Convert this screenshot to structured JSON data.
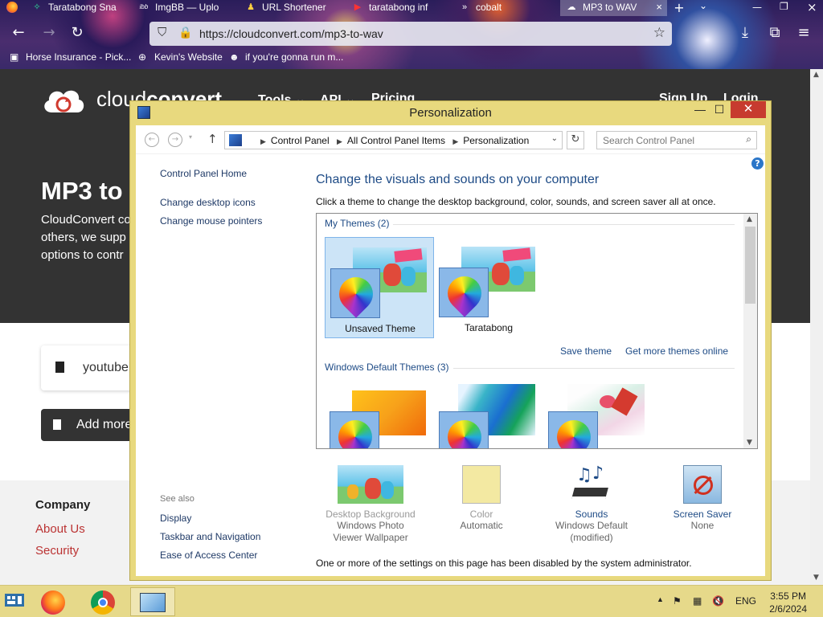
{
  "browser": {
    "tabs": [
      {
        "label": "Taratabong Sna",
        "icon": "✧"
      },
      {
        "label": "ImgBB — Uplo",
        "icon": "ibb"
      },
      {
        "label": "URL Shortener",
        "icon": "♟"
      },
      {
        "label": "taratabong inf",
        "icon": "▶"
      },
      {
        "label": "cobalt",
        "icon": "»"
      },
      {
        "label": "MP3 to WAV",
        "icon": "☁"
      }
    ],
    "url": "https://cloudconvert.com/mp3-to-wav",
    "bookmarks": [
      "Horse Insurance - Pick...",
      "Kevin's Website",
      "if you're gonna run m..."
    ]
  },
  "site": {
    "brand_light": "cloud",
    "brand_bold": "convert",
    "menu": [
      "Tools ⌄",
      "API ⌄",
      "Pricing"
    ],
    "menu_right": [
      "Sign Up",
      "Login"
    ],
    "heading": "MP3 to",
    "description": [
      "CloudConvert co",
      "others, we supp",
      "options to contr"
    ],
    "file_label": "youtube",
    "add_more": "Add more",
    "footer": {
      "company": "Company",
      "links": [
        "About Us",
        "Security"
      ]
    }
  },
  "window": {
    "title": "Personalization",
    "breadcrumb": [
      "Control Panel",
      "All Control Panel Items",
      "Personalization"
    ],
    "search_placeholder": "Search Control Panel",
    "sidebar": [
      "Control Panel Home",
      "Change desktop icons",
      "Change mouse pointers"
    ],
    "see_also_label": "See also",
    "see_also": [
      "Display",
      "Taskbar and Navigation",
      "Ease of Access Center"
    ],
    "heading": "Change the visuals and sounds on your computer",
    "subheading": "Click a theme to change the desktop background, color, sounds, and screen saver all at once.",
    "my_themes_label": "My Themes (2)",
    "my_themes": [
      "Unsaved Theme",
      "Taratabong"
    ],
    "save_theme": "Save theme",
    "get_more": "Get more themes online",
    "default_themes_label": "Windows Default Themes (3)",
    "settings": [
      {
        "label": "Desktop Background",
        "value": "Windows Photo Viewer Wallpaper",
        "enabled": false
      },
      {
        "label": "Color",
        "value": "Automatic",
        "enabled": false
      },
      {
        "label": "Sounds",
        "value": "Windows Default (modified)",
        "enabled": true
      },
      {
        "label": "Screen Saver",
        "value": "None",
        "enabled": true
      }
    ],
    "notice": "One or more of the settings on this page has been disabled by the system administrator."
  },
  "taskbar": {
    "language": "ENG",
    "time": "3:55 PM",
    "date": "2/6/2024"
  },
  "colors": {
    "window_frame": "#e8d97e",
    "close_button": "#c73b2f",
    "link": "#1e4b86",
    "site_dark": "#333333",
    "footer_link": "#bb3333"
  }
}
